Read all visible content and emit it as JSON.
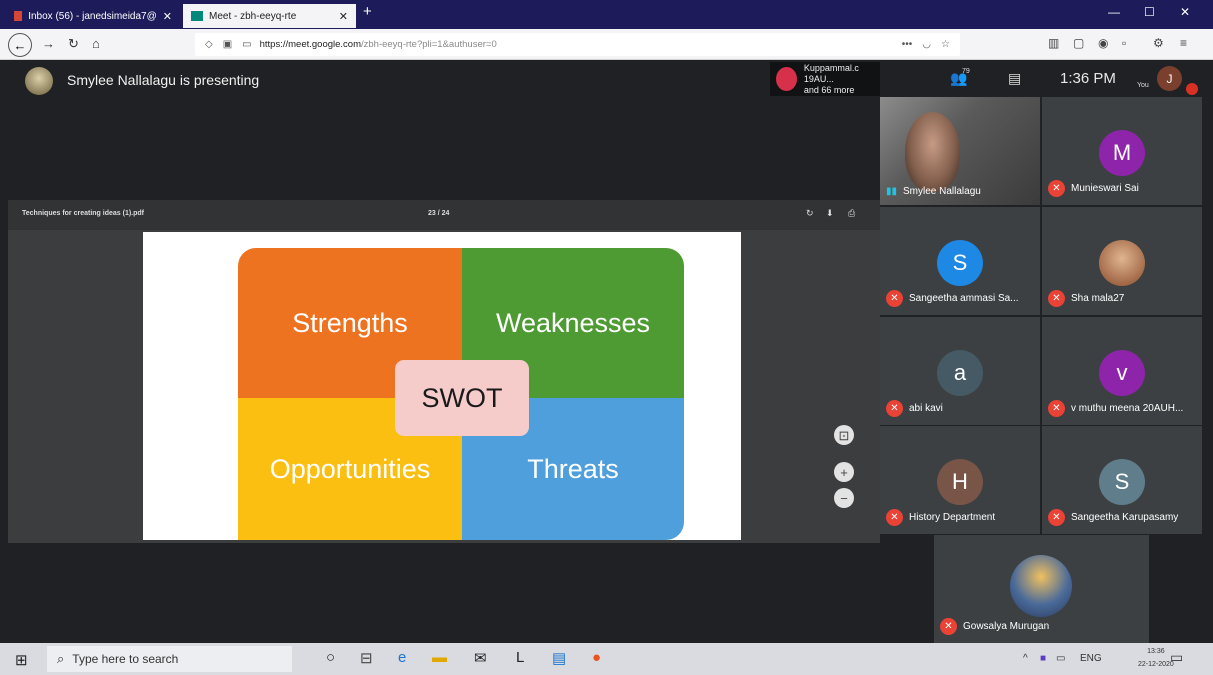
{
  "browser": {
    "tabs": [
      {
        "label": "Inbox (56) - janedsimeida7@"
      },
      {
        "label": "Meet - zbh-eeyq-rte"
      }
    ],
    "new_tab": "+",
    "url_host": "https://meet.google.com",
    "url_path": "/zbh-eeyq-rte?pli=1&authuser=0",
    "window_controls": [
      "—",
      "☐",
      "✕"
    ]
  },
  "meet": {
    "presenting_text": "Smylee Nallalagu is presenting",
    "notification_line1": "Kuppammal.c 19AU...",
    "notification_line2": "and 66 more",
    "people_count": "79",
    "clock": "1:36 PM",
    "you_label": "You",
    "you_initial": "J",
    "presentation": {
      "file_name": "Techniques for creating ideas (1).pdf",
      "page": "23 / 24",
      "quadrants": {
        "strengths": "Strengths",
        "weaknesses": "Weaknesses",
        "opportunities": "Opportunities",
        "threats": "Threats"
      },
      "center": "SWOT"
    },
    "participants": [
      {
        "name": "Smylee Nallalagu",
        "type": "video"
      },
      {
        "name": "Munieswari Sai",
        "initial": "M",
        "color": "#8e24aa"
      },
      {
        "name": "Sangeetha ammasi Sa...",
        "initial": "S",
        "color": "#1e88e5"
      },
      {
        "name": "Sha mala27",
        "type": "photo"
      },
      {
        "name": "abi kavi",
        "initial": "a",
        "color": "#455a64"
      },
      {
        "name": "v muthu meena 20AUH...",
        "initial": "v",
        "color": "#8e24aa"
      },
      {
        "name": "History Department",
        "initial": "H",
        "color": "#795548"
      },
      {
        "name": "Sangeetha Karupasamy",
        "initial": "S",
        "color": "#607d8b"
      },
      {
        "name": "Gowsalya Murugan",
        "type": "photo"
      }
    ]
  },
  "taskbar": {
    "search_placeholder": "Type here to search",
    "lang": "ENG",
    "time": "13:36",
    "date": "22-12-2020"
  }
}
